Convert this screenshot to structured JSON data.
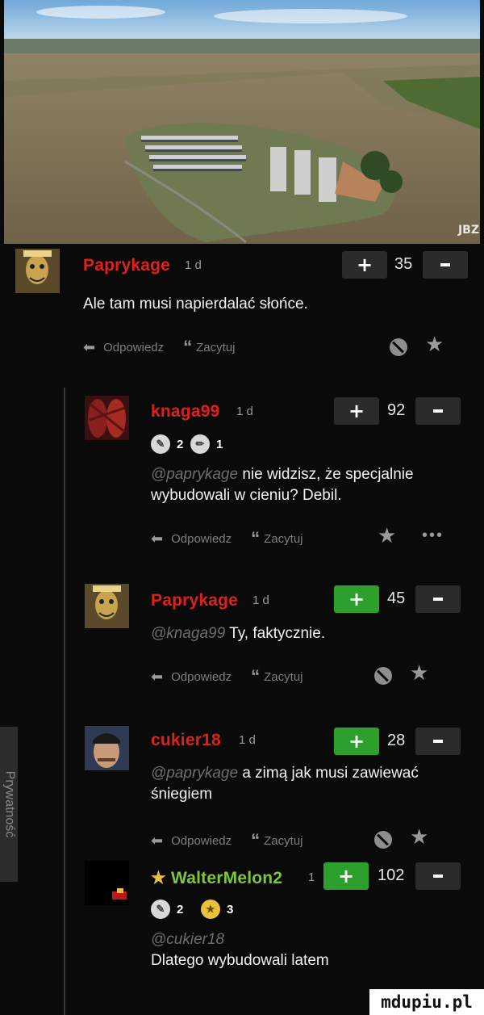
{
  "side_tab": {
    "label": "Prywatność"
  },
  "photo_watermark": "JBZ",
  "brand_watermark": "mdupiu.pl",
  "comments": [
    {
      "username": "Paprykage",
      "username_color": "#e0201a",
      "time": "1 d",
      "score": "35",
      "text": "Ale tam musi napierdalać słońce.",
      "actions": {
        "reply": "Odpowiedz",
        "quote": "Zacytuj"
      }
    },
    {
      "username": "knaga99",
      "username_color": "#e0201a",
      "time": "1 d",
      "score": "92",
      "badges": [
        {
          "icon": "pen-badge",
          "count": "2"
        },
        {
          "icon": "pencil-badge",
          "count": "1"
        }
      ],
      "mention": "@paprykage",
      "text": "nie widzisz, że specjalnie wybudowali w cieniu? Debil.",
      "actions": {
        "reply": "Odpowiedz",
        "quote": "Zacytuj"
      }
    },
    {
      "username": "Paprykage",
      "username_color": "#e0201a",
      "time": "1 d",
      "score": "45",
      "mention": "@knaga99",
      "text": "Ty, faktycznie.",
      "actions": {
        "reply": "Odpowiedz",
        "quote": "Zacytuj"
      }
    },
    {
      "username": "cukier18",
      "username_color": "#e0201a",
      "time": "1 d",
      "score": "28",
      "mention": "@paprykage",
      "text": "a zimą jak musi zawiewać śniegiem",
      "actions": {
        "reply": "Odpowiedz",
        "quote": "Zacytuj"
      }
    },
    {
      "username": "WalterMelon2",
      "username_color": "#7fc63a",
      "time": "1",
      "score": "102",
      "badges": [
        {
          "icon": "pen-badge",
          "count": "2"
        },
        {
          "icon": "star-badge",
          "count": "3"
        }
      ],
      "mention": "@cukier18",
      "text": "Dlatego wybudowali latem"
    }
  ],
  "icons": {
    "plus": "+",
    "star": "★",
    "dots": "•••",
    "reply": "arrow-back-icon"
  }
}
